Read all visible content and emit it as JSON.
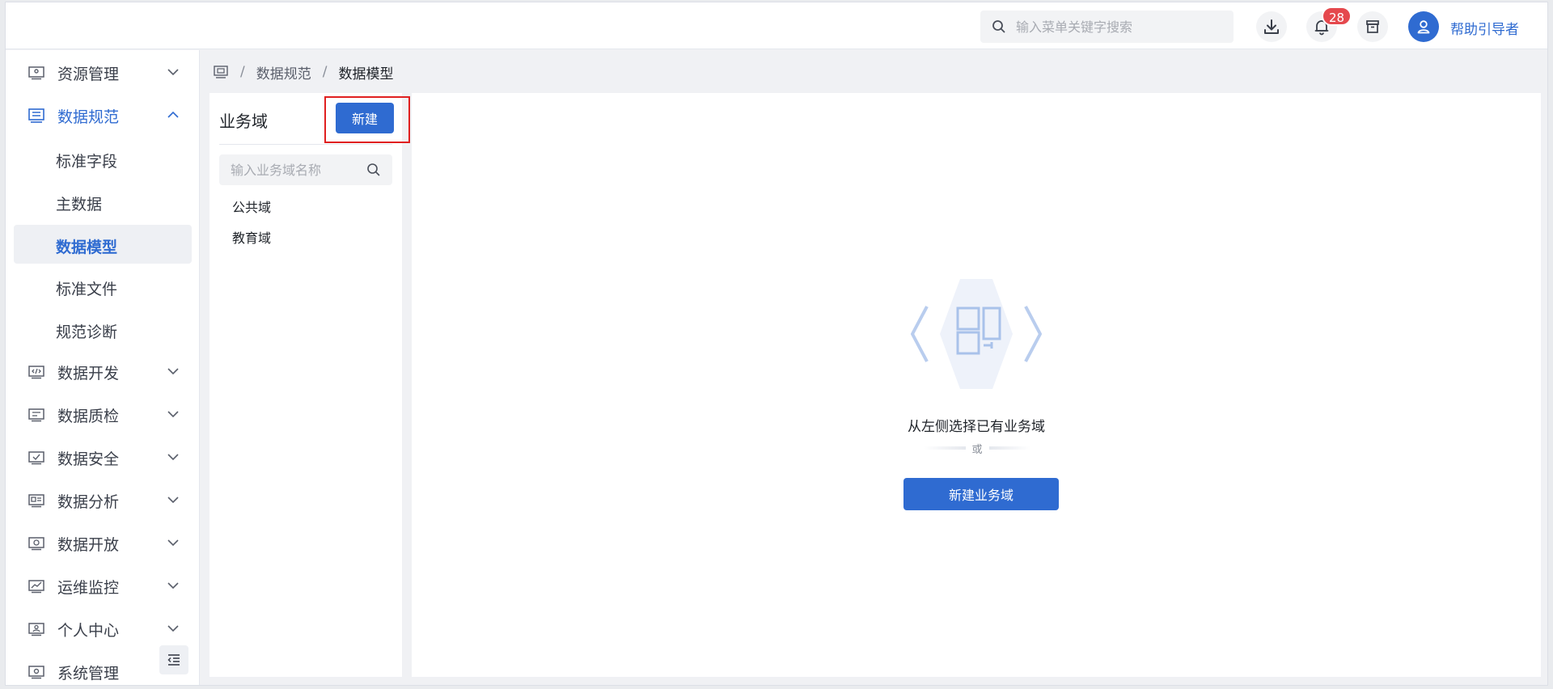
{
  "header": {
    "search_placeholder": "输入菜单关键字搜索",
    "notification_count": "28",
    "username": "帮助引导者",
    "icons": [
      "search-icon",
      "download-icon",
      "bell-icon",
      "archive-icon",
      "user-icon"
    ]
  },
  "sidebar": {
    "items": [
      {
        "label": "资源管理",
        "icon": "resource-icon",
        "expanded": false
      },
      {
        "label": "数据规范",
        "icon": "database-icon",
        "expanded": true
      },
      {
        "label": "数据开发",
        "icon": "code-icon",
        "expanded": false
      },
      {
        "label": "数据质检",
        "icon": "quality-icon",
        "expanded": false
      },
      {
        "label": "数据安全",
        "icon": "security-icon",
        "expanded": false
      },
      {
        "label": "数据分析",
        "icon": "analysis-icon",
        "expanded": false
      },
      {
        "label": "数据开放",
        "icon": "open-icon",
        "expanded": false
      },
      {
        "label": "运维监控",
        "icon": "monitor-icon",
        "expanded": false
      },
      {
        "label": "个人中心",
        "icon": "person-icon",
        "expanded": false
      },
      {
        "label": "系统管理",
        "icon": "system-icon",
        "expanded": false
      }
    ],
    "sub_items": [
      {
        "label": "标准字段",
        "selected": false
      },
      {
        "label": "主数据",
        "selected": false
      },
      {
        "label": "数据模型",
        "selected": true
      },
      {
        "label": "标准文件",
        "selected": false
      },
      {
        "label": "规范诊断",
        "selected": false
      }
    ]
  },
  "breadcrumb": {
    "items": [
      "数据规范",
      "数据模型"
    ],
    "separator": "/"
  },
  "domain_panel": {
    "title": "业务域",
    "new_button": "新建",
    "search_placeholder": "输入业务域名称",
    "domains": [
      "公共域",
      "教育域"
    ]
  },
  "main": {
    "empty_text": "从左侧选择已有业务域",
    "or_text": "或",
    "new_domain_button": "新建业务域"
  },
  "colors": {
    "accent": "#2f6bd1",
    "badge": "#e5484d",
    "highlight": "#e02020"
  }
}
